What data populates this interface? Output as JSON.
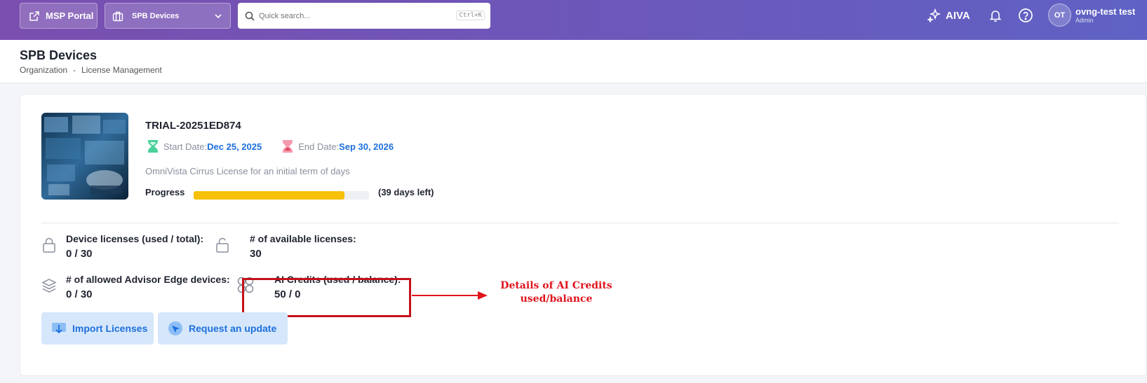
{
  "topbar": {
    "msp_label": "MSP Portal",
    "org_label": "SPB Devices",
    "search_placeholder": "Quick search...",
    "search_shortcut": "Ctrl+K",
    "aiva_label": "AIVA",
    "avatar_initials": "OT",
    "user_name": "ovng-test test",
    "user_role": "Admin"
  },
  "header": {
    "title": "SPB Devices",
    "breadcrumb": [
      "Organization",
      "-",
      "License Management"
    ]
  },
  "license": {
    "id": "TRIAL-20251ED874",
    "start_label": "Start Date:",
    "start_value": "Dec 25, 2025",
    "end_label": "End Date:",
    "end_value": "Sep 30, 2026",
    "description": "OmniVista Cirrus License for an initial term of days",
    "progress_label": "Progress",
    "progress_fraction": 0.86,
    "days_left": "(39 days left)"
  },
  "stats": {
    "device": {
      "label": "Device licenses (used / total):",
      "value": "0 / 30"
    },
    "available": {
      "label": "# of available licenses:",
      "value": "30"
    },
    "advisor": {
      "label": "# of allowed Advisor Edge devices:",
      "value": "0 / 30"
    },
    "ai_credits": {
      "label": "AI Credits (used / balance):",
      "value": "50 / 0"
    }
  },
  "annotation": {
    "line1": "Details of AI Credits",
    "line2": "used/balance"
  },
  "buttons": {
    "import": "Import Licenses",
    "update": "Request an update"
  },
  "colors": {
    "accent": "#1d6fdc",
    "progress": "#f7c009",
    "highlight": "#c4111a"
  }
}
